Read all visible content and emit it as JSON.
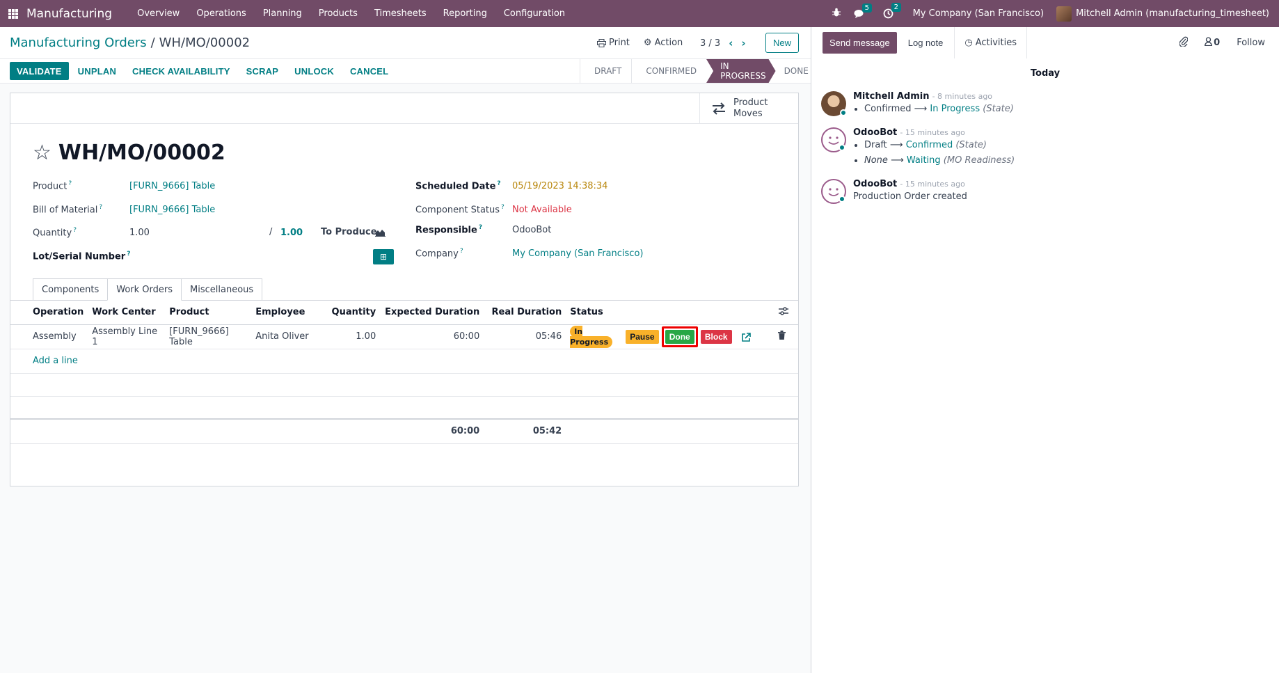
{
  "navbar": {
    "brand": "Manufacturing",
    "menu": [
      "Overview",
      "Operations",
      "Planning",
      "Products",
      "Timesheets",
      "Reporting",
      "Configuration"
    ],
    "messages_count": "5",
    "activities_count": "2",
    "company": "My Company (San Francisco)",
    "user": "Mitchell Admin (manufacturing_timesheet)"
  },
  "control": {
    "breadcrumb_parent": "Manufacturing Orders",
    "breadcrumb_sep": "/",
    "breadcrumb_current": "WH/MO/00002",
    "print_label": "Print",
    "action_label": "Action",
    "pager": "3 / 3",
    "new_label": "New"
  },
  "statusbar": {
    "buttons": [
      "VALIDATE",
      "UNPLAN",
      "CHECK AVAILABILITY",
      "SCRAP",
      "UNLOCK",
      "CANCEL"
    ],
    "stages": [
      "DRAFT",
      "CONFIRMED",
      "IN PROGRESS",
      "DONE"
    ],
    "active_stage": "IN PROGRESS"
  },
  "form": {
    "smart_button": "Product Moves",
    "title": "WH/MO/00002",
    "product_label": "Product",
    "product_value": "[FURN_9666] Table",
    "bom_label": "Bill of Material",
    "bom_value": "[FURN_9666] Table",
    "quantity_label": "Quantity",
    "quantity_value": "1.00",
    "quantity_sep": "/",
    "quantity_target": "1.00",
    "to_produce_label": "To Produce",
    "lot_label": "Lot/Serial Number",
    "scheduled_label": "Scheduled Date",
    "scheduled_value": "05/19/2023 14:38:34",
    "component_status_label": "Component Status",
    "component_status_value": "Not Available",
    "responsible_label": "Responsible",
    "responsible_value": "OdooBot",
    "company_label": "Company",
    "company_value": "My Company (San Francisco)",
    "help_mark": "?"
  },
  "tabs": [
    "Components",
    "Work Orders",
    "Miscellaneous"
  ],
  "work_orders": {
    "columns": [
      "Operation",
      "Work Center",
      "Product",
      "Employee",
      "Quantity",
      "Expected Duration",
      "Real Duration",
      "Status"
    ],
    "row": {
      "operation": "Assembly",
      "work_center": "Assembly Line 1",
      "product": "[FURN_9666] Table",
      "employee": "Anita Oliver",
      "quantity": "1.00",
      "expected": "60:00",
      "real": "05:46",
      "status": "In Progress",
      "pause": "Pause",
      "done": "Done",
      "block": "Block"
    },
    "add_line": "Add a line",
    "total_expected": "60:00",
    "total_real": "05:42"
  },
  "chatter": {
    "send_message": "Send message",
    "log_note": "Log note",
    "activities": "Activities",
    "followers_count": "0",
    "follow": "Follow",
    "today": "Today",
    "messages": [
      {
        "author": "Mitchell Admin",
        "time": "- 8 minutes ago",
        "from": "Confirmed",
        "to": "In Progress",
        "field": "(State)"
      },
      {
        "author": "OdooBot",
        "time": "- 15 minutes ago",
        "from": "Draft",
        "to": "Confirmed",
        "field": "(State)",
        "from2": "None",
        "to2": "Waiting",
        "field2": "(MO Readiness)"
      },
      {
        "author": "OdooBot",
        "time": "- 15 minutes ago",
        "body": "Production Order created"
      }
    ]
  }
}
